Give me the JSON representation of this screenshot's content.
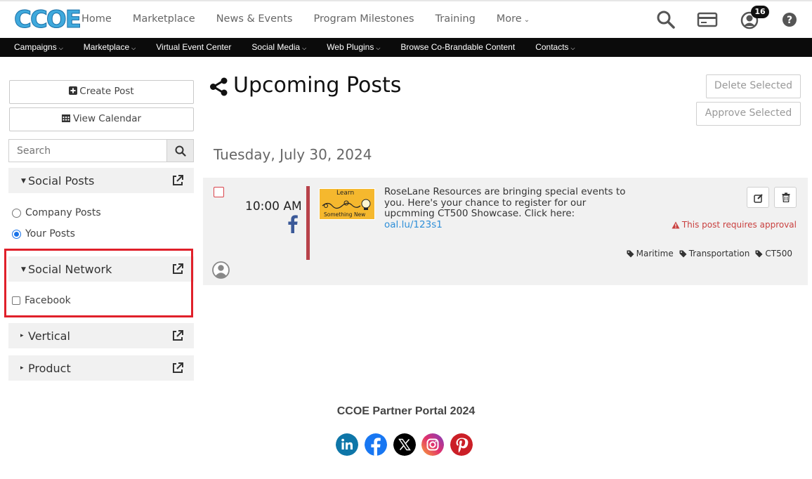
{
  "brand": {
    "logo_text": "CCOE",
    "accent": "#3fa9dc"
  },
  "topnav": {
    "items": [
      "Home",
      "Marketplace",
      "News & Events",
      "Program Milestones",
      "Training",
      "More"
    ],
    "notification_count": "16",
    "icons": [
      "search-icon",
      "credit-card-icon",
      "user-icon",
      "help-icon"
    ]
  },
  "subnav": {
    "items": [
      "Campaigns",
      "Marketplace",
      "Virtual Event Center",
      "Social Media",
      "Web Plugins",
      "Browse Co-Brandable Content",
      "Contacts"
    ]
  },
  "sidebar": {
    "create_post": "Create Post",
    "view_calendar": "View Calendar",
    "search_placeholder": "Search",
    "panels": {
      "social_posts": {
        "title": "Social Posts",
        "options": [
          "Company Posts",
          "Your Posts"
        ],
        "selected": "Your Posts"
      },
      "social_network": {
        "title": "Social Network",
        "options": [
          "Facebook"
        ],
        "checked": []
      },
      "vertical": {
        "title": "Vertical"
      },
      "product": {
        "title": "Product"
      }
    }
  },
  "main": {
    "title": "Upcoming Posts",
    "delete_selected": "Delete Selected",
    "approve_selected": "Approve Selected",
    "date_heading": "Tuesday, July 30, 2024",
    "post": {
      "time": "10:00 AM",
      "network": "facebook",
      "thumb_line1": "Learn",
      "thumb_line2": "Something New",
      "text": "RoseLane Resources are bringing special events to you. Here's your chance to register for our upcmming CT500 Showcase. Click here:",
      "link": "oal.lu/123s1",
      "approval_notice": "This post requires approval",
      "tags": [
        "Maritime",
        "Transportation",
        "CT500"
      ]
    }
  },
  "footer": {
    "text": "CCOE Partner Portal 2024",
    "social": [
      "linkedin-icon",
      "facebook-icon",
      "x-icon",
      "instagram-icon",
      "pinterest-icon"
    ]
  },
  "colors": {
    "danger": "#c9403f",
    "post_bar": "#b8424a",
    "highlight_box": "#e0202a",
    "link": "#2f8fd8"
  }
}
